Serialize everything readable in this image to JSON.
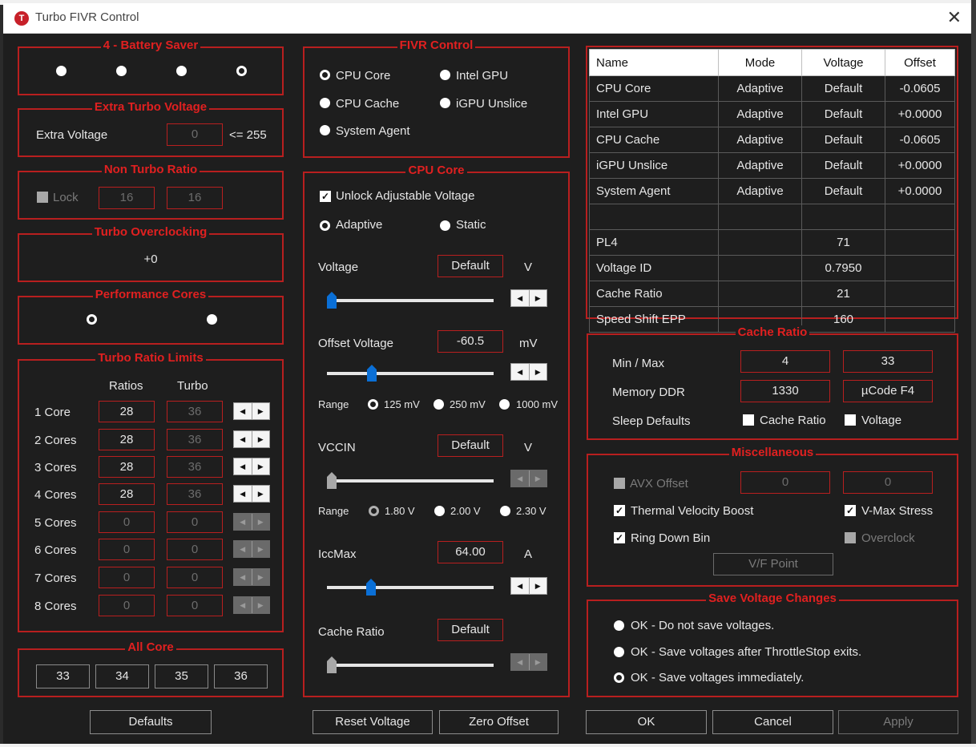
{
  "window": {
    "title": "Turbo FIVR Control",
    "icon_letter": "T",
    "close": "✕"
  },
  "battery": {
    "title": "4 - Battery Saver",
    "selected_index": 3,
    "count": 4
  },
  "extra_turbo": {
    "title": "Extra Turbo Voltage",
    "label": "Extra Voltage",
    "value": "0",
    "limit": "<= 255"
  },
  "non_turbo": {
    "title": "Non Turbo Ratio",
    "lock_label": "Lock",
    "lock_checked": false,
    "val1": "16",
    "val2": "16"
  },
  "turbo_oc": {
    "title": "Turbo Overclocking",
    "value": "+0"
  },
  "perf_cores": {
    "title": "Performance Cores",
    "selected_index": 0
  },
  "turbo_ratio": {
    "title": "Turbo Ratio Limits",
    "col_ratios": "Ratios",
    "col_turbo": "Turbo",
    "rows": [
      {
        "label": "1 Core",
        "ratio": "28",
        "turbo": "36",
        "active": true
      },
      {
        "label": "2 Cores",
        "ratio": "28",
        "turbo": "36",
        "active": true
      },
      {
        "label": "3 Cores",
        "ratio": "28",
        "turbo": "36",
        "active": true
      },
      {
        "label": "4 Cores",
        "ratio": "28",
        "turbo": "36",
        "active": true
      },
      {
        "label": "5 Cores",
        "ratio": "0",
        "turbo": "0",
        "active": false
      },
      {
        "label": "6 Cores",
        "ratio": "0",
        "turbo": "0",
        "active": false
      },
      {
        "label": "7 Cores",
        "ratio": "0",
        "turbo": "0",
        "active": false
      },
      {
        "label": "8 Cores",
        "ratio": "0",
        "turbo": "0",
        "active": false
      }
    ]
  },
  "all_core": {
    "title": "All Core",
    "values": [
      "33",
      "34",
      "35",
      "36"
    ]
  },
  "fivr": {
    "title": "FIVR Control",
    "options": [
      "CPU Core",
      "Intel GPU",
      "CPU Cache",
      "iGPU Unslice",
      "System Agent"
    ],
    "selected": "CPU Core"
  },
  "cpu_core": {
    "title": "CPU Core",
    "unlock_label": "Unlock Adjustable Voltage",
    "unlock_checked": true,
    "mode_adaptive": "Adaptive",
    "mode_static": "Static",
    "mode_selected": "Adaptive",
    "voltage": {
      "label": "Voltage",
      "value": "Default",
      "unit": "V"
    },
    "offset": {
      "label": "Offset Voltage",
      "value": "-60.5",
      "unit": "mV"
    },
    "range_label": "Range",
    "offset_ranges": [
      "125 mV",
      "250 mV",
      "1000 mV"
    ],
    "offset_range_selected": 0,
    "vccin": {
      "label": "VCCIN",
      "value": "Default",
      "unit": "V"
    },
    "vccin_ranges": [
      "1.80 V",
      "2.00 V",
      "2.30 V"
    ],
    "vccin_range_selected": 0,
    "iccmax": {
      "label": "IccMax",
      "value": "64.00",
      "unit": "A"
    },
    "cache_ratio": {
      "label": "Cache Ratio",
      "value": "Default"
    }
  },
  "table": {
    "headers": [
      "Name",
      "Mode",
      "Voltage",
      "Offset"
    ],
    "rows": [
      [
        "CPU Core",
        "Adaptive",
        "Default",
        "-0.0605"
      ],
      [
        "Intel GPU",
        "Adaptive",
        "Default",
        "+0.0000"
      ],
      [
        "CPU Cache",
        "Adaptive",
        "Default",
        "-0.0605"
      ],
      [
        "iGPU Unslice",
        "Adaptive",
        "Default",
        "+0.0000"
      ],
      [
        "System Agent",
        "Adaptive",
        "Default",
        "+0.0000"
      ],
      [
        "",
        "",
        "",
        ""
      ],
      [
        "PL4",
        "",
        "71",
        ""
      ],
      [
        "Voltage ID",
        "",
        "0.7950",
        ""
      ],
      [
        "Cache Ratio",
        "",
        "21",
        ""
      ],
      [
        "Speed Shift EPP",
        "",
        "160",
        ""
      ]
    ]
  },
  "cache_ratio": {
    "title": "Cache Ratio",
    "minmax_label": "Min / Max",
    "min": "4",
    "max": "33",
    "ddr_label": "Memory DDR",
    "ddr": "1330",
    "ucode": "µCode F4",
    "sleep_label": "Sleep Defaults",
    "sleep_cache": "Cache Ratio",
    "sleep_voltage": "Voltage"
  },
  "misc": {
    "title": "Miscellaneous",
    "avx_label": "AVX Offset",
    "avx1": "0",
    "avx2": "0",
    "tvb_label": "Thermal Velocity Boost",
    "vmax_label": "V-Max Stress",
    "ring_label": "Ring Down Bin",
    "overclock_label": "Overclock",
    "vf_label": "V/F Point"
  },
  "save": {
    "title": "Save Voltage Changes",
    "options": [
      "OK - Do not save voltages.",
      "OK - Save voltages after ThrottleStop exits.",
      "OK - Save voltages immediately."
    ],
    "selected": 2
  },
  "buttons": {
    "defaults": "Defaults",
    "reset": "Reset Voltage",
    "zero": "Zero Offset",
    "ok": "OK",
    "cancel": "Cancel",
    "apply": "Apply"
  },
  "colors": {
    "accent": "#b81f1f",
    "title_red": "#e02020",
    "slider_blue": "#0a6fd6",
    "bg": "#1e1e1e"
  }
}
